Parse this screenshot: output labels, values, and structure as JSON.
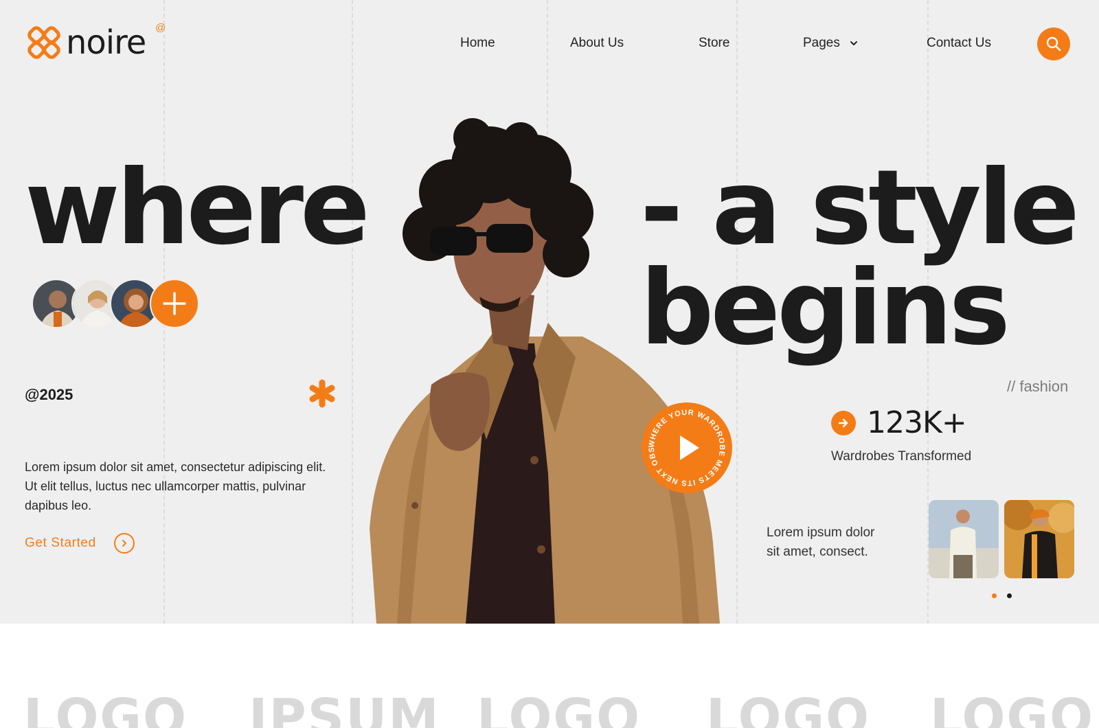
{
  "brand": {
    "name": "noire",
    "mark": "@",
    "accent": "#f47c16",
    "text_color": "#1c1c1c",
    "hero_bg": "#efefef"
  },
  "nav": {
    "items": [
      {
        "label": "Home"
      },
      {
        "label": "About Us"
      },
      {
        "label": "Store"
      },
      {
        "label": "Pages",
        "has_dropdown": true
      },
      {
        "label": "Contact Us"
      }
    ],
    "search_icon": "search-icon"
  },
  "hero": {
    "headline_left": "where",
    "headline_right_1": "- a style",
    "headline_right_2": "begins",
    "year": "@2025",
    "description": "Lorem ipsum dolor sit amet, consectetur adipiscing elit. Ut elit tellus, luctus nec ullamcorper mattis, pulvinar dapibus leo.",
    "cta_label": "Get Started",
    "play_badge_text": "WHERE YOUR WARDROBE MEETS ITS NEXT OBSESSION",
    "fashion_tag": "// fashion",
    "stat_value": "123K+",
    "stat_label": "Wardrobes Transformed",
    "small_copy": "Lorem ipsum dolor sit amet, consect."
  },
  "carousel": {
    "active_index": 0,
    "count": 2
  },
  "partners": [
    "LOGO",
    "IPSUM",
    "LOGO",
    "LOGO",
    "LOGO"
  ]
}
